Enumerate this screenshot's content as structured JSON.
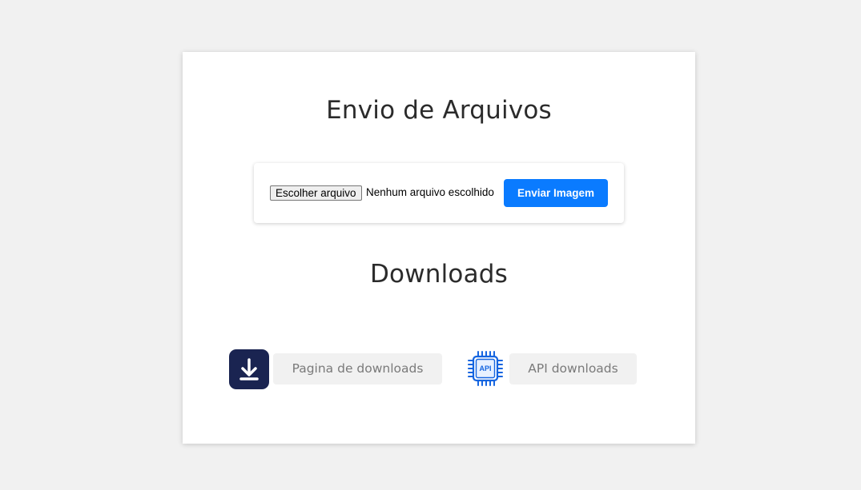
{
  "upload": {
    "title": "Envio de Arquivos",
    "file_button_label": "Escolher arquivo",
    "file_status": "Nenhum arquivo escolhido",
    "submit_label": "Enviar Imagem"
  },
  "downloads": {
    "title": "Downloads",
    "links": [
      {
        "label": "Pagina de downloads",
        "icon": "download-icon"
      },
      {
        "label": "API downloads",
        "icon": "api-chip-icon",
        "icon_text": "API"
      }
    ]
  },
  "colors": {
    "background": "#f1f1f1",
    "card": "#ffffff",
    "primary": "#0a7bff",
    "download_icon_bg": "#1a2451",
    "api_icon": "#1565e0",
    "link_bg": "#f1f1f1",
    "link_text": "#7a7a7a"
  }
}
